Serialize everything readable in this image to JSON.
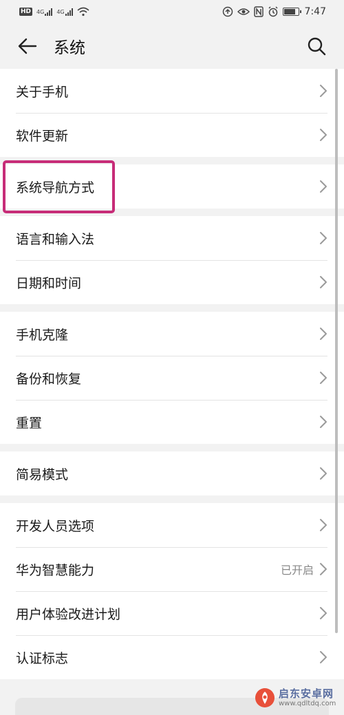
{
  "status_bar": {
    "hd_badge": "HD",
    "network_1": "4G",
    "network_2": "4G",
    "time": "7:47",
    "battery_level": 0.85
  },
  "header": {
    "title": "系统",
    "back_icon": "arrow-left-icon",
    "search_icon": "search-icon"
  },
  "groups": [
    {
      "items": [
        {
          "label": "关于手机"
        },
        {
          "label": "软件更新"
        }
      ]
    },
    {
      "items": [
        {
          "label": "系统导航方式"
        }
      ]
    },
    {
      "items": [
        {
          "label": "语言和输入法"
        },
        {
          "label": "日期和时间"
        }
      ]
    },
    {
      "items": [
        {
          "label": "手机克隆"
        },
        {
          "label": "备份和恢复"
        },
        {
          "label": "重置"
        }
      ]
    },
    {
      "items": [
        {
          "label": "简易模式"
        }
      ]
    },
    {
      "items": [
        {
          "label": "开发人员选项"
        },
        {
          "label": "华为智慧能力",
          "value": "已开启"
        },
        {
          "label": "用户体验改进计划"
        },
        {
          "label": "认证标志"
        }
      ]
    }
  ],
  "watermark": {
    "name": "启东安卓网",
    "url": "www.qdltdq.com"
  },
  "colors": {
    "highlight": "#c72c78",
    "background": "#f2f2f2",
    "card": "#ffffff"
  }
}
